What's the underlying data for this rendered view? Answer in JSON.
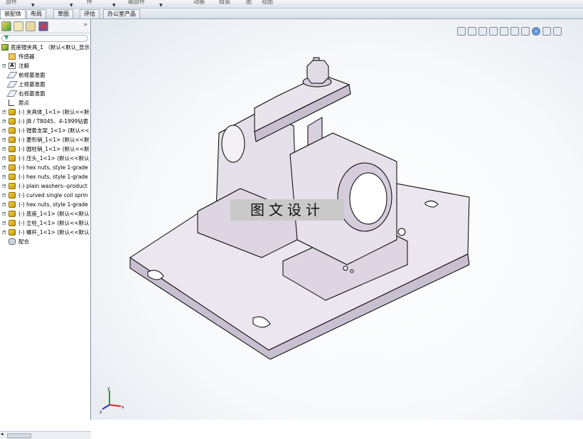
{
  "ribbon": {
    "items": [
      "部件",
      "件",
      "输部件",
      "动画",
      "组装",
      "图",
      "视图"
    ]
  },
  "tabs": [
    {
      "label": "装配体",
      "active": true
    },
    {
      "label": "布局",
      "active": false
    },
    {
      "label": "草图",
      "active": false
    },
    {
      "label": "评估",
      "active": false
    },
    {
      "label": "办公室产品",
      "active": false
    }
  ],
  "tree": {
    "items": [
      {
        "label": "底座镗夹具_1 （默认<默认_显示",
        "icon": "assembly-icon"
      },
      {
        "label": "传感器",
        "icon": "folder-icon"
      },
      {
        "label": "注解",
        "icon": "annotation-icon",
        "expandable": true
      },
      {
        "label": "前视基准面",
        "icon": "plane-icon"
      },
      {
        "label": "上视基准面",
        "icon": "plane-icon"
      },
      {
        "label": "右视基准面",
        "icon": "plane-icon"
      },
      {
        "label": "原点",
        "icon": "origin-icon"
      },
      {
        "label": "(-) 夹具体_1<1> (默认<<默",
        "icon": "part-icon",
        "expandable": true
      },
      {
        "label": "(-) JB / T8045．4-1999钻套",
        "icon": "part-icon",
        "expandable": true
      },
      {
        "label": "(-) 镗套支架_1<1> (默认<<",
        "icon": "part-icon",
        "expandable": true
      },
      {
        "label": "(-) 菱形销_1<1> (默认<<默",
        "icon": "part-icon",
        "expandable": true
      },
      {
        "label": "(-) 圆柱销_1<1> (默认<<默",
        "icon": "part-icon",
        "expandable": true
      },
      {
        "label": "(-) 压头_1<1> (默认<<默认",
        "icon": "part-icon",
        "expandable": true
      },
      {
        "label": "(-) hex nuts, style 1-grade",
        "icon": "part-icon",
        "expandable": true
      },
      {
        "label": "(-) hex nuts, style 1-grade",
        "icon": "part-icon",
        "expandable": true
      },
      {
        "label": "(-) plain washers--product",
        "icon": "part-icon",
        "expandable": true
      },
      {
        "label": "(-) curved single coil sprin",
        "icon": "part-icon",
        "expandable": true
      },
      {
        "label": "(-) hex nuts, style 1-grade",
        "icon": "part-icon",
        "expandable": true
      },
      {
        "label": "(-) 底座_1<1> (默认<<默认",
        "icon": "part-icon",
        "expandable": true
      },
      {
        "label": "(-) 立柱_1<1> (默认<<默认",
        "icon": "part-icon",
        "expandable": true
      },
      {
        "label": "(-) 螺杆_1<1> (默认<<默认",
        "icon": "part-icon",
        "expandable": true
      },
      {
        "label": "配合",
        "icon": "mate-icon"
      }
    ]
  },
  "viewport": {
    "watermark": "图文设计"
  },
  "triad": {
    "x": "x",
    "y": "y",
    "z": "z"
  },
  "colors": {
    "part_face": "#ebe6ef",
    "part_shade": "#c8bfd0",
    "edge": "#000000"
  }
}
